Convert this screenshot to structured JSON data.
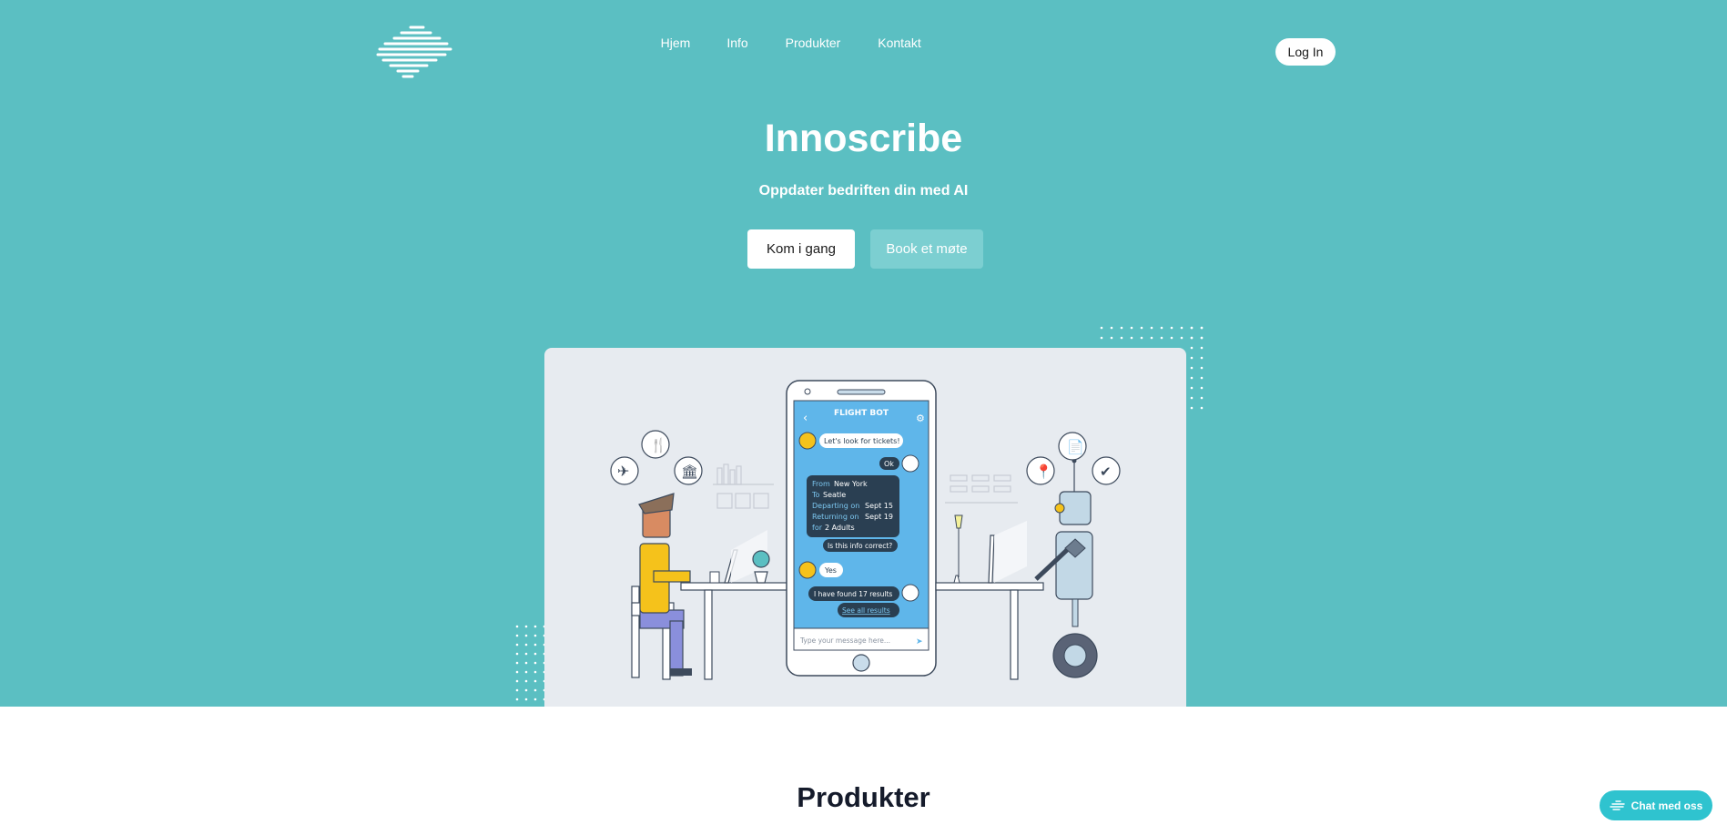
{
  "brand": {
    "logo_icon": "brand-stripes-logo"
  },
  "nav": {
    "items": [
      "Hjem",
      "Info",
      "Produkter",
      "Kontakt"
    ],
    "login_label": "Log In"
  },
  "hero": {
    "title": "Innoscribe",
    "subtitle": "Oppdater bedriften din med AI",
    "primary_button": "Kom i gang",
    "secondary_button": "Book et møte"
  },
  "illustration": {
    "phone_header": "FLIGHT BOT",
    "messages": {
      "user_1": "Let's look for tickets!",
      "bot_ok": "Ok",
      "from_label": "From",
      "from_value": "New York",
      "to_label": "To",
      "to_value": "Seatle",
      "departing_label": "Departing on",
      "departing_value": "Sept 15",
      "returning_label": "Returning on",
      "returning_value": "Sept 19",
      "for_label": "for",
      "for_value": "2 Adults",
      "bot_question": "Is this info correct?",
      "user_yes": "Yes",
      "bot_results": "I have found 17 results",
      "bot_link": "See all results"
    },
    "input_placeholder": "Type your message here..."
  },
  "products": {
    "title": "Produkter"
  },
  "chat_widget": {
    "label": "Chat med oss"
  },
  "colors": {
    "hero_bg": "#5bbfc2",
    "accent": "#2fc3cf",
    "phone_screen": "#5fb6ea",
    "bubble_dark": "#2a3f52"
  }
}
